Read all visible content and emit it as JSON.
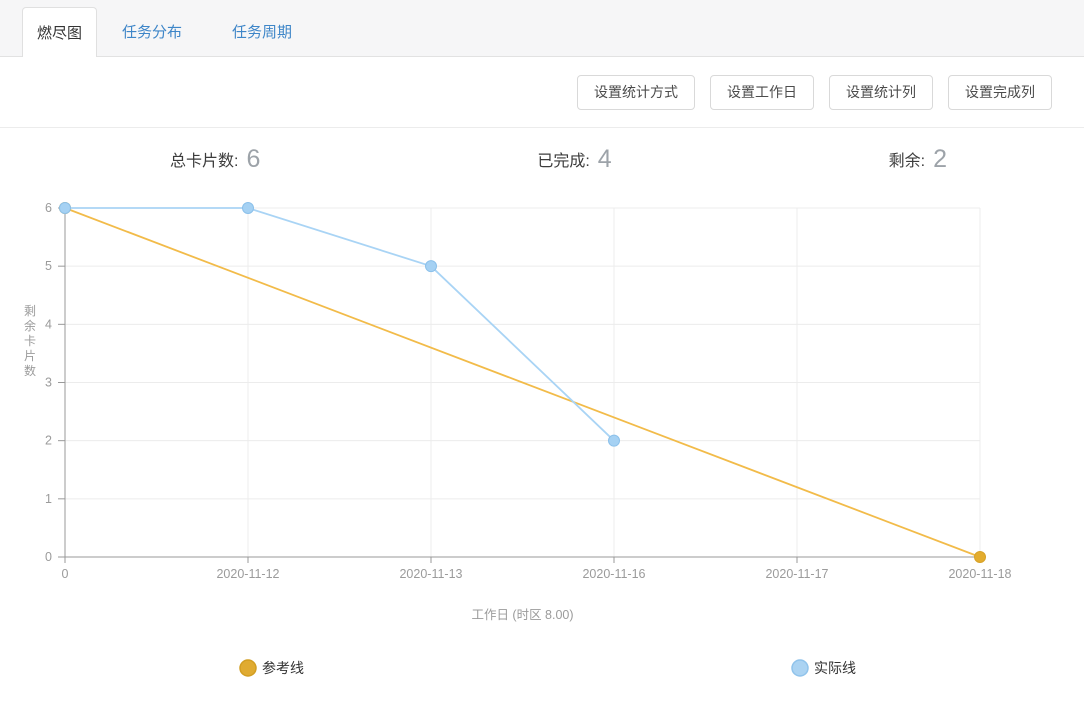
{
  "tabs": {
    "items": [
      {
        "label": "燃尽图",
        "active": true
      },
      {
        "label": "任务分布",
        "active": false
      },
      {
        "label": "任务周期",
        "active": false
      }
    ]
  },
  "toolbar": {
    "buttons": [
      {
        "label": "设置统计方式"
      },
      {
        "label": "设置工作日"
      },
      {
        "label": "设置统计列"
      },
      {
        "label": "设置完成列"
      }
    ]
  },
  "stats": {
    "items": [
      {
        "label": "总卡片数:",
        "value": "6"
      },
      {
        "label": "已完成:",
        "value": "4"
      },
      {
        "label": "剩余:",
        "value": "2"
      }
    ]
  },
  "chart_data": {
    "type": "line",
    "title": "燃尽图",
    "x_categories": [
      "0",
      "2020-11-12",
      "2020-11-13",
      "2020-11-16",
      "2020-11-17",
      "2020-11-18"
    ],
    "xlabel": "工作日 (时区 8.00)",
    "ylabel": "剩余卡片数",
    "ylim": [
      0,
      6
    ],
    "yticks": [
      0,
      1,
      2,
      3,
      4,
      5,
      6
    ],
    "grid": true,
    "legend_position": "bottom",
    "series": [
      {
        "name": "参考线",
        "x_index": [
          0,
          5
        ],
        "values": [
          6,
          0
        ],
        "line_color": "#f2bb49",
        "dot_fill": "#e3ac2e",
        "dot_stroke": "#d7a227",
        "legend_fill": "#e0ab31",
        "legend_stroke": "#d29e22"
      },
      {
        "name": "实际线",
        "x_index": [
          0,
          1,
          2,
          3
        ],
        "values": [
          6,
          6,
          5,
          2
        ],
        "line_color": "#a9d4f5",
        "dot_fill": "#a5d1f3",
        "dot_stroke": "#8bc0ea",
        "legend_fill": "#abd3f2",
        "legend_stroke": "#90c3eb"
      }
    ],
    "colors": {
      "axis": "#999999",
      "grid": "#ececec",
      "tick_label": "#9b9b9b",
      "axis_title": "#9b9b9b",
      "legend_text": "#333333"
    }
  }
}
